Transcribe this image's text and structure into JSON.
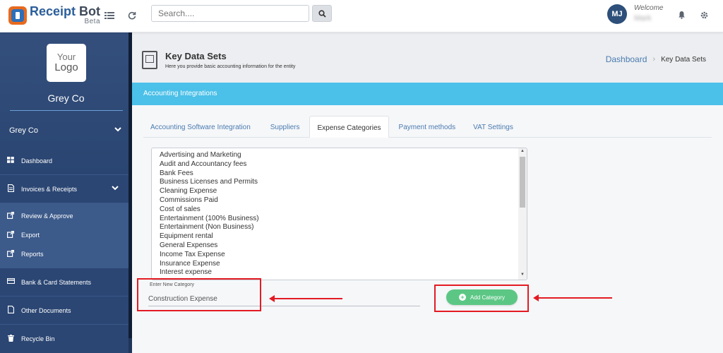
{
  "app": {
    "name_part1": "Receipt ",
    "name_part2": "Bot",
    "edition": "Beta"
  },
  "topbar": {
    "search_placeholder": "Search....",
    "avatar_initials": "MJ",
    "welcome": "Welcome",
    "user_name": "Mark"
  },
  "sidebar": {
    "logo_line1": "Your",
    "logo_line2": "Logo",
    "company_name": "Grey Co",
    "company_select": "Grey Co",
    "items": [
      {
        "label": "Dashboard",
        "icon": "dashboard-icon"
      },
      {
        "label": "Invoices & Receipts",
        "icon": "document-icon"
      },
      {
        "label": "Review & Approve",
        "icon": "external-link-icon"
      },
      {
        "label": "Export",
        "icon": "external-link-icon"
      },
      {
        "label": "Reports",
        "icon": "external-link-icon"
      },
      {
        "label": "Bank & Card Statements",
        "icon": "credit-card-icon"
      },
      {
        "label": "Other Documents",
        "icon": "file-icon"
      },
      {
        "label": "Recycle Bin",
        "icon": "trash-icon"
      }
    ]
  },
  "header": {
    "title": "Key Data Sets",
    "subtitle": "Here you provide basic accounting information for the entity",
    "breadcrumb_home": "Dashboard",
    "breadcrumb_current": "Key Data Sets"
  },
  "banner": {
    "title": "Accounting Integrations"
  },
  "tabs": [
    {
      "label": "Accounting Software Integration"
    },
    {
      "label": "Suppliers"
    },
    {
      "label": "Expense Categories"
    },
    {
      "label": "Payment methods"
    },
    {
      "label": "VAT Settings"
    }
  ],
  "categories": [
    "Advertising and Marketing",
    "Audit and Accountancy fees",
    "Bank Fees",
    "Business Licenses and Permits",
    "Cleaning Expense",
    "Commissions Paid",
    "Cost of sales",
    "Entertainment (100% Business)",
    "Entertainment (Non Business)",
    "Equipment rental",
    "General Expenses",
    "Income Tax Expense",
    "Insurance Expense",
    "Interest expense"
  ],
  "new_category": {
    "label": "Enter New Category",
    "value": "Construction Expense",
    "button": "Add Category"
  },
  "colors": {
    "sidebar": "#2b4673",
    "banner": "#4bc0e8",
    "add_button": "#5cc785",
    "highlight": "#e31b23"
  }
}
